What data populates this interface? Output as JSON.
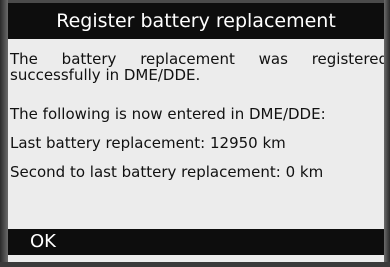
{
  "dialog": {
    "title": "Register battery replacement",
    "message_line1": "The battery replacement was registered",
    "message_line2": "successfully in DME/DDE.",
    "info_header": "The following is now entered in DME/DDE:",
    "last_replacement": "Last battery replacement: 12950 km",
    "second_to_last_replacement": "Second to last battery replacement: 0 km",
    "ok_label": "OK"
  },
  "colors": {
    "bar_background": "#0d0d0d",
    "bar_text": "#ffffff",
    "screen_background": "#ececec",
    "body_text": "#111111",
    "device_frame": "#4a4a4a"
  }
}
